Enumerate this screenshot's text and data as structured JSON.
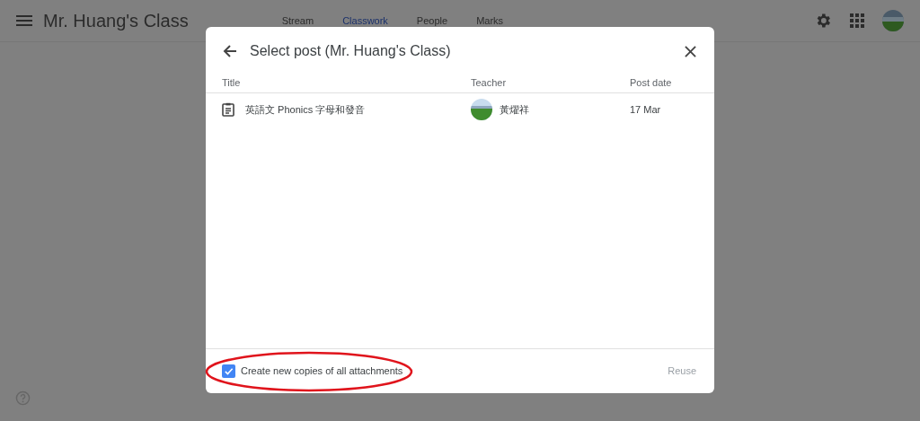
{
  "app_bar": {
    "title": "Mr. Huang's Class",
    "tabs": [
      {
        "label": "Stream",
        "selected": false
      },
      {
        "label": "Classwork",
        "selected": true
      },
      {
        "label": "People",
        "selected": false
      },
      {
        "label": "Marks",
        "selected": false
      }
    ]
  },
  "dialog": {
    "title": "Select post (Mr. Huang's Class)",
    "columns": [
      "Title",
      "Teacher",
      "Post date"
    ],
    "rows": [
      {
        "title": "英語文 Phonics 字母和發音",
        "teacher": "黃燿祥",
        "post_date": "17 Mar",
        "selected": false
      }
    ],
    "copy_option": {
      "label": "Create new copies of all attachments",
      "checked": true
    },
    "button": {
      "label": "Reuse",
      "disabled": true
    }
  }
}
